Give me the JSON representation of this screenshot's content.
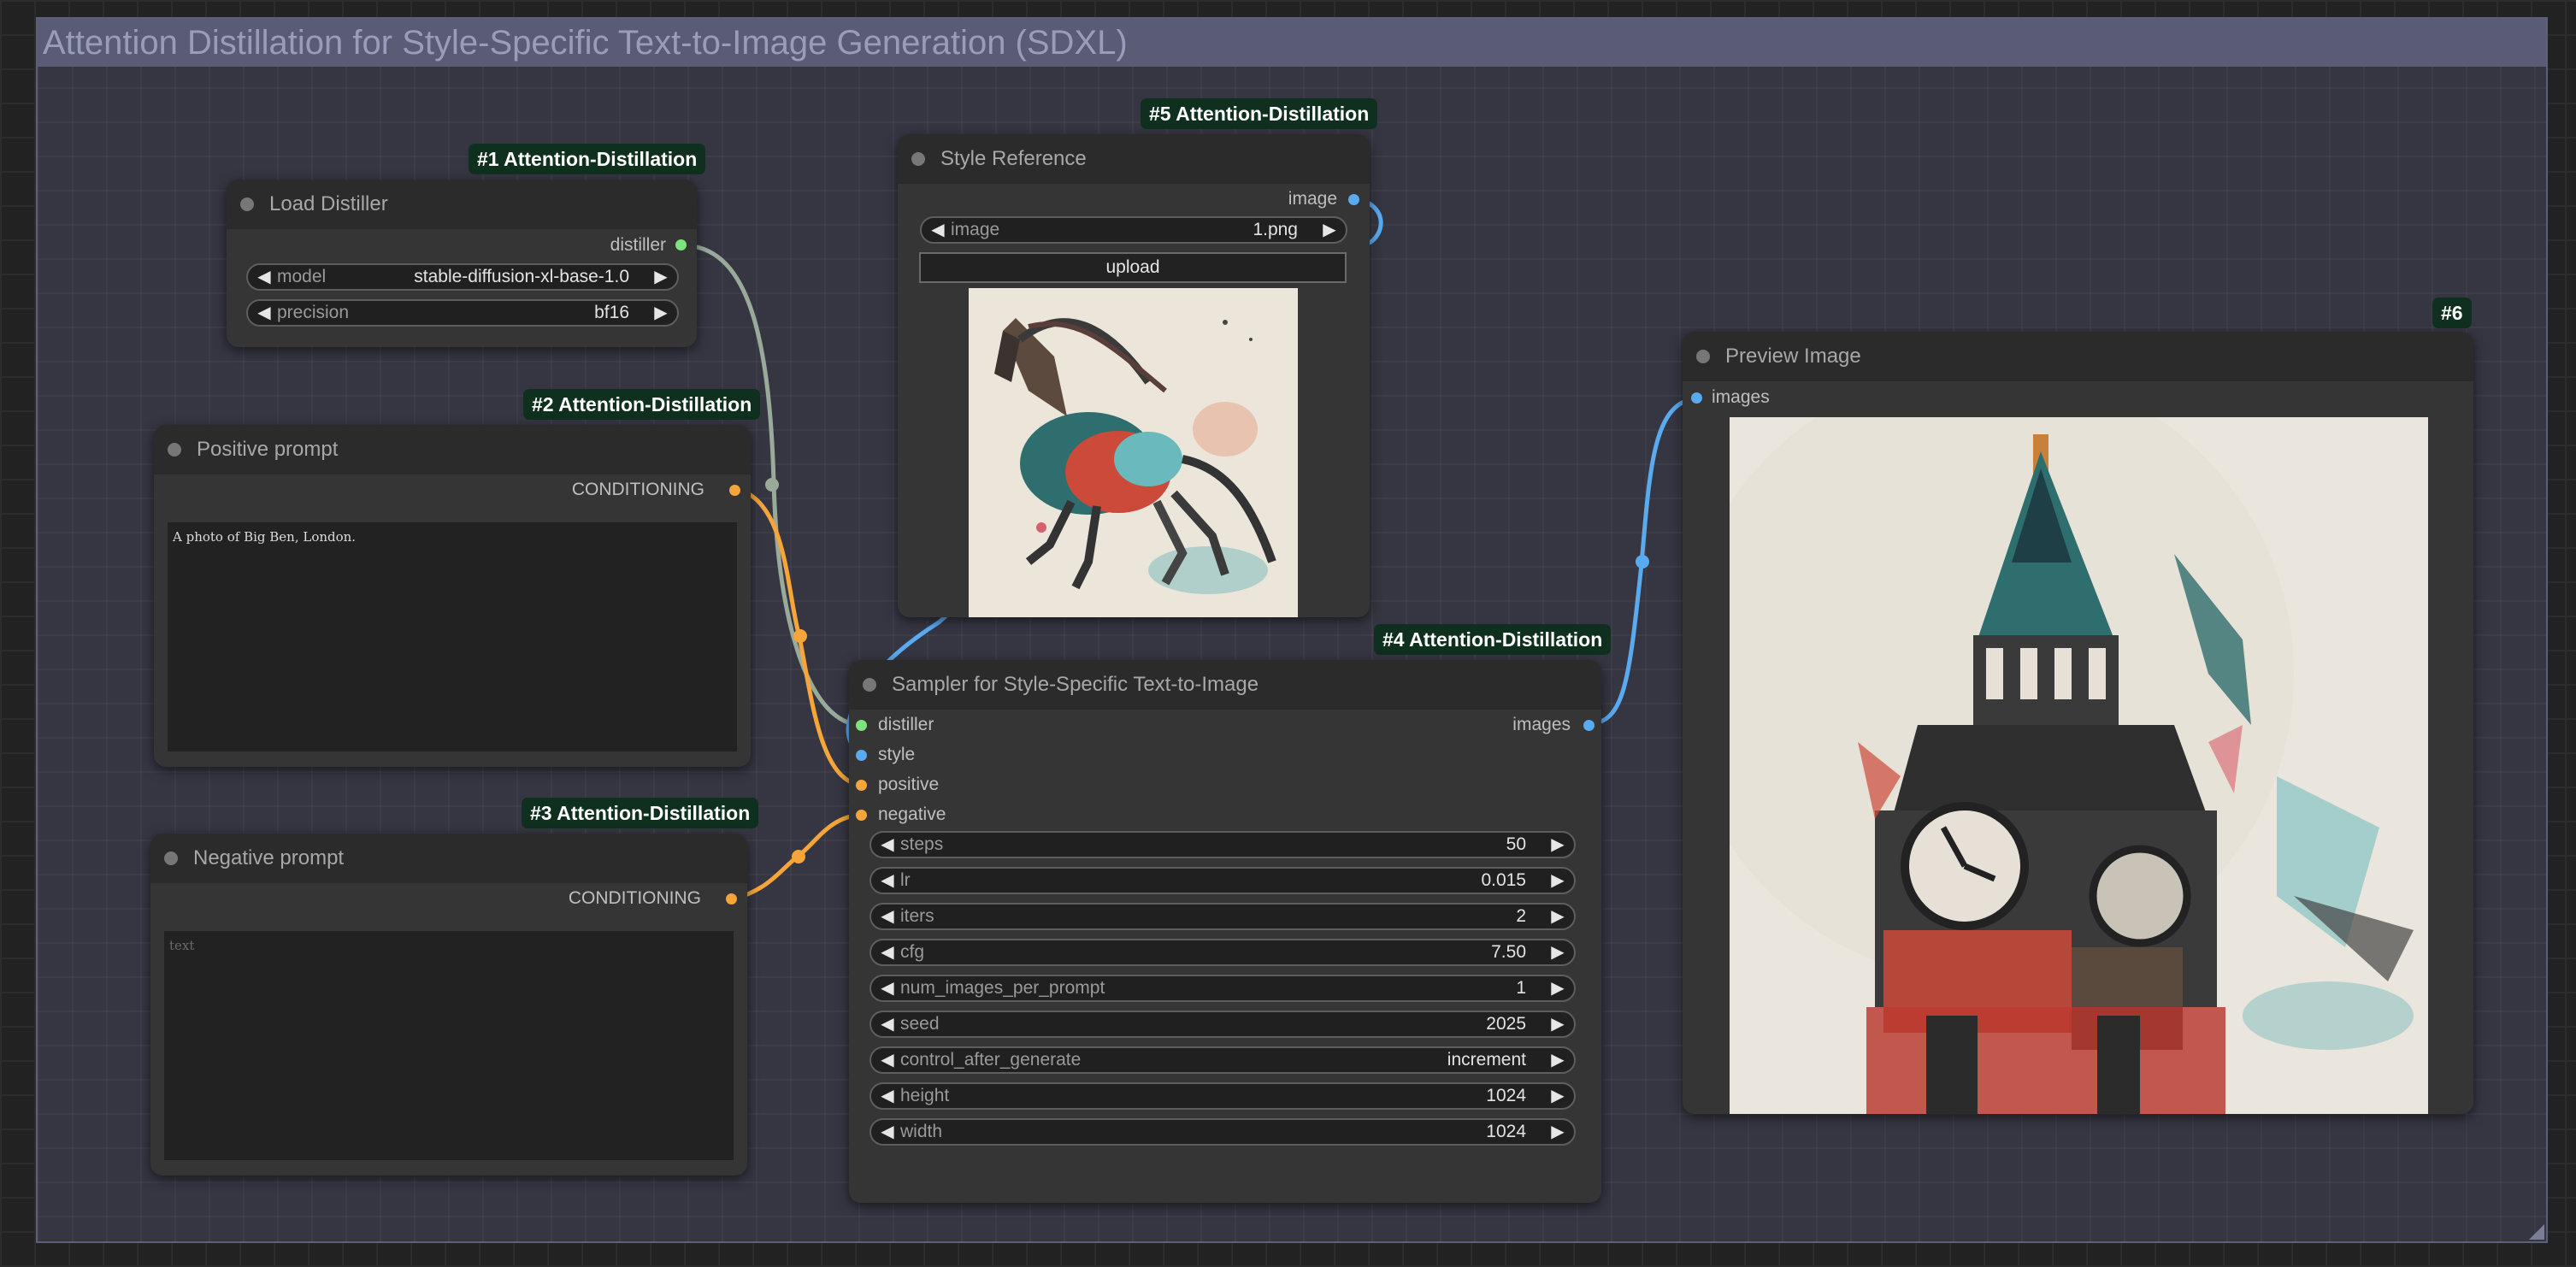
{
  "group": {
    "title": "Attention Distillation for Style-Specific Text-to-Image Generation (SDXL)"
  },
  "nodes": {
    "load_distiller": {
      "badge": "#1 Attention-Distillation",
      "title": "Load Distiller",
      "output": "distiller",
      "widgets": [
        {
          "label": "model",
          "value": "stable-diffusion-xl-base-1.0"
        },
        {
          "label": "precision",
          "value": "bf16"
        }
      ]
    },
    "positive_prompt": {
      "badge": "#2 Attention-Distillation",
      "title": "Positive prompt",
      "output": "CONDITIONING",
      "text": "A photo of Big Ben, London."
    },
    "negative_prompt": {
      "badge": "#3 Attention-Distillation",
      "title": "Negative prompt",
      "output": "CONDITIONING",
      "placeholder": "text"
    },
    "style_reference": {
      "badge": "#5 Attention-Distillation",
      "title": "Style Reference",
      "output": "image",
      "widget": {
        "label": "image",
        "value": "1.png"
      },
      "upload_label": "upload"
    },
    "sampler": {
      "badge": "#4 Attention-Distillation",
      "title": "Sampler for Style-Specific Text-to-Image",
      "inputs": [
        "distiller",
        "style",
        "positive",
        "negative"
      ],
      "output": "images",
      "widgets": [
        {
          "label": "steps",
          "value": "50"
        },
        {
          "label": "lr",
          "value": "0.015"
        },
        {
          "label": "iters",
          "value": "2"
        },
        {
          "label": "cfg",
          "value": "7.50"
        },
        {
          "label": "num_images_per_prompt",
          "value": "1"
        },
        {
          "label": "seed",
          "value": "2025"
        },
        {
          "label": "control_after_generate",
          "value": "increment"
        },
        {
          "label": "height",
          "value": "1024"
        },
        {
          "label": "width",
          "value": "1024"
        }
      ]
    },
    "preview_image": {
      "badge": "#6",
      "title": "Preview Image",
      "input": "images"
    }
  },
  "colors": {
    "distiller_link": "#7ee27e",
    "image_link": "#5aaaf0",
    "conditioning_link": "#f5a53a",
    "badge_bg": "#10301f"
  },
  "icons": {
    "left_arrow": "◀",
    "right_arrow": "▶"
  }
}
